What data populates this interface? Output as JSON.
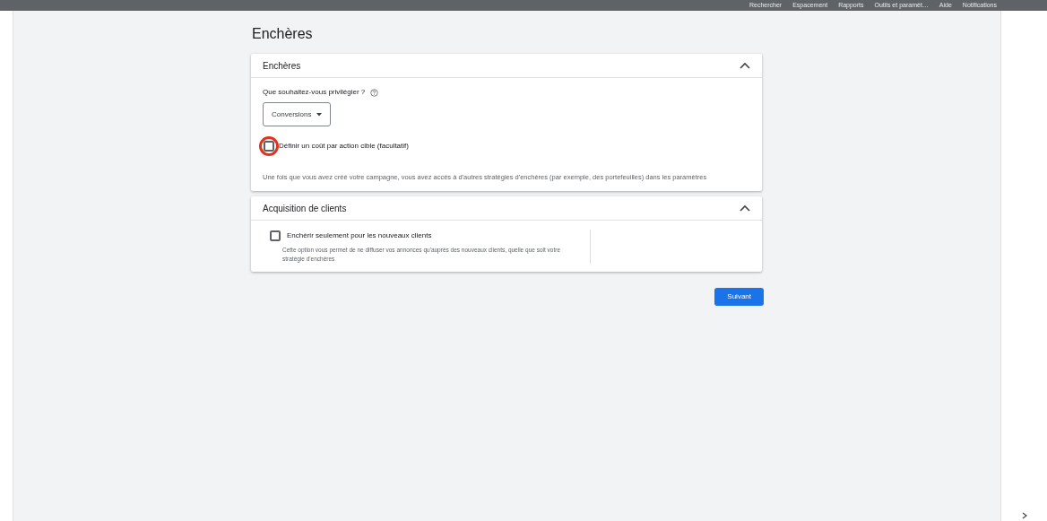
{
  "top_bar": {
    "items": [
      "Rechercher",
      "Espacement",
      "Rapports",
      "Outils et paramèt…",
      "Aide",
      "Notifications"
    ]
  },
  "page_title": "Enchères",
  "panels": [
    {
      "kind": "bidding",
      "title": "Enchères",
      "expanded": true,
      "question": "Que souhaitez-vous privilégier ?",
      "dropdown": "Conversions",
      "checkbox": {
        "label": "Définir un coût par action cible (facultatif)",
        "checked": false,
        "highlighted": true
      },
      "note": "Une fois que vous avez créé votre campagne, vous avez accès à d'autres stratégies d'enchères (par exemple, des portefeuilles) dans les paramètres"
    },
    {
      "kind": "acquisition",
      "title": "Acquisition de clients",
      "expanded": true,
      "checkbox": {
        "label": "Enchérir seulement pour les nouveaux clients",
        "checked": false,
        "highlighted": false
      },
      "description": "Cette option vous permet de ne diffuser vos annonces qu'auprès des nouveaux clients, quelle que soit votre stratégie d'enchères"
    }
  ],
  "next_button": "Suivant"
}
